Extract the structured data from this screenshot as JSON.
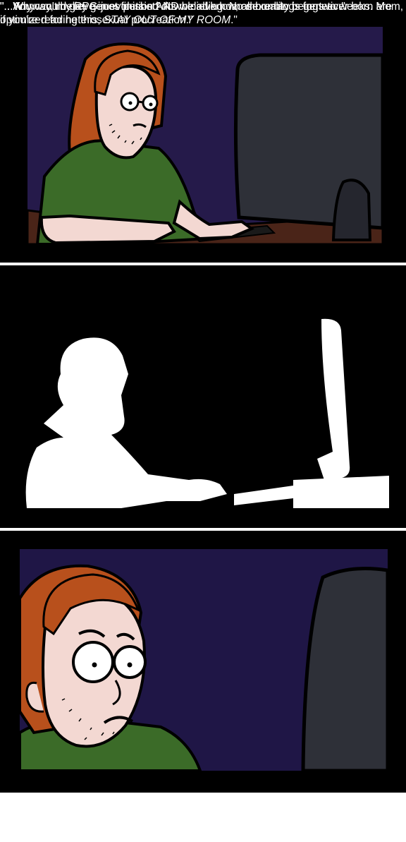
{
  "panels": [
    {
      "caption": "\"...You can't believe in evolution AND believe homosexuality is genetic.\""
    },
    {
      "caption": "\"...Why would gay genes persist? As we all know, all human beings ever born are optimized for heterosexual procreation.\""
    },
    {
      "caption_before": "\"...Anyway, my RPG just finished downloading. No more blogs for two weeks. Mom, if you're reading this, ",
      "caption_emphasis": "STAY OUT OF MY ROOM",
      "caption_after": ".\""
    }
  ],
  "colors": {
    "frame": "#000000",
    "background_dark": "#251a4a",
    "hair": "#b8501c",
    "shirt": "#3b6b28",
    "skin": "#f3d8d2",
    "monitor": "#2e3038",
    "desk": "#4a2418",
    "silhouette": "#ffffff"
  }
}
